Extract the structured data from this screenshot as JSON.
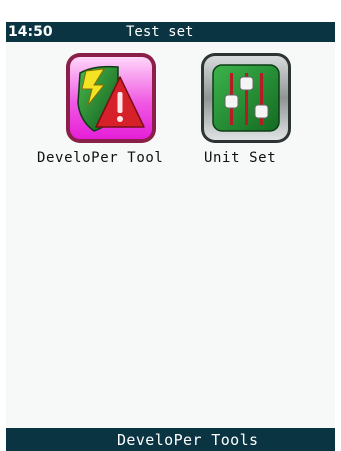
{
  "status_bar": {
    "time": "14:50",
    "title": "Test set"
  },
  "apps": [
    {
      "label": "DeveloPer Tool",
      "icon": "developer-tool-icon"
    },
    {
      "label": "Unit Set",
      "icon": "unit-set-sliders-icon"
    }
  ],
  "bottom_bar": {
    "label": "DeveloPer Tools"
  },
  "colors": {
    "bar_background": "#0b3442",
    "screen_background": "#f7f9f9",
    "developer_icon_magenta": "#e51fd8",
    "developer_icon_warning_red": "#d6202a",
    "unit_icon_green": "#1f8a2f"
  }
}
